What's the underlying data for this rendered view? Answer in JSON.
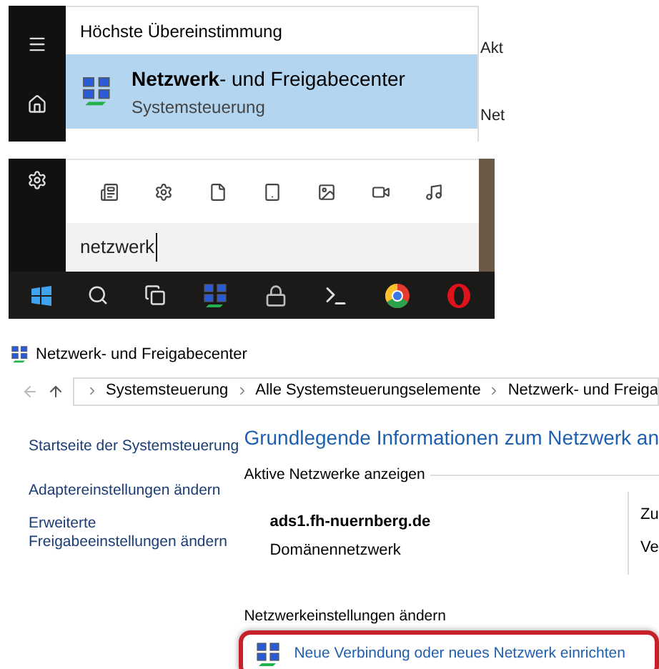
{
  "start_menu": {
    "section_title": "Höchste Übereinstimmung",
    "best_match": {
      "title": "**Netzwerk**- und Freigabecenter",
      "subtitle": "Systemsteuerung",
      "selected": true
    },
    "search": {
      "value": "netzwerk"
    }
  },
  "background_texts": [
    "Akt",
    "Net"
  ],
  "window": {
    "title": "Netzwerk- und Freigabecenter",
    "breadcrumb": [
      "Systemsteuerung",
      "Alle Systemsteuerungselemente",
      "Netzwerk- und Freiga"
    ],
    "sidebar": {
      "items": [
        "Startseite der Systemsteuerung",
        "Adaptereinstellungen ändern",
        "Erweiterte Freigabeeinstellungen ändern"
      ]
    },
    "heading": "Grundlegende Informationen zum Netzwerk an",
    "active_networks": {
      "label": "Aktive Netzwerke anzeigen",
      "network": {
        "name": "ads1.fh-nuernberg.de",
        "type": "Domänennetzwerk"
      },
      "column_2": [
        "Zu",
        "Ve"
      ]
    },
    "settings": {
      "label": "Netzwerkeinstellungen ändern",
      "links": [
        {
          "text": "Neue Verbindung oder neues Netzwerk einrichten",
          "highlighted": true
        }
      ]
    }
  }
}
